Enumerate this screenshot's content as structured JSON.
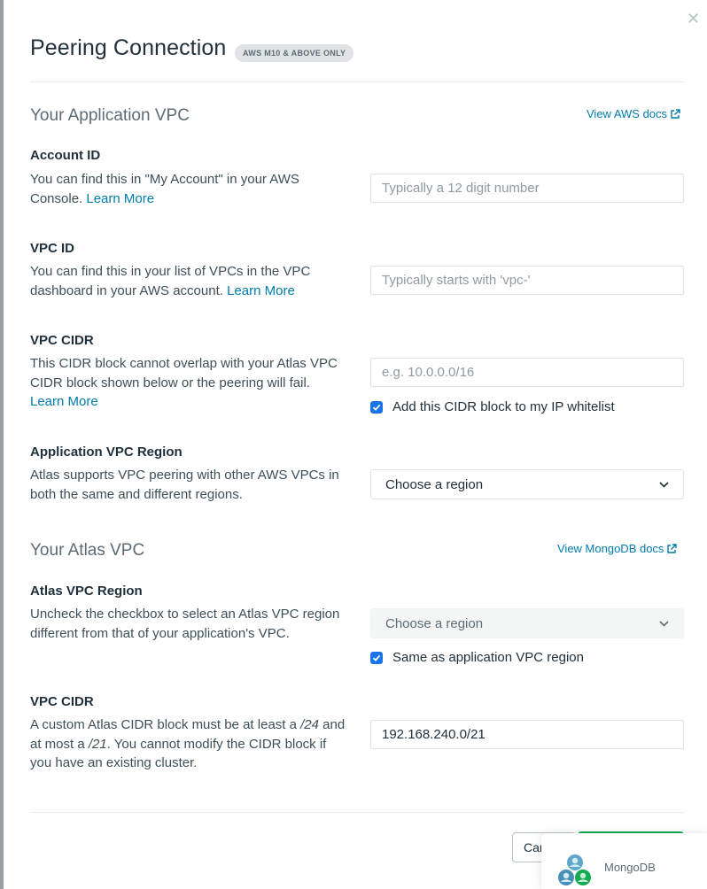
{
  "modal": {
    "title": "Peering Connection",
    "badge": "AWS M10 & ABOVE ONLY",
    "close_icon": "close-icon"
  },
  "app_section": {
    "title": "Your Application VPC",
    "docs_link": "View AWS docs",
    "account_id": {
      "label": "Account ID",
      "desc": "You can find this in \"My Account\" in your AWS Console.",
      "link": "Learn More",
      "placeholder": "Typically a 12 digit number",
      "value": ""
    },
    "vpc_id": {
      "label": "VPC ID",
      "desc": "You can find this in your list of VPCs in the VPC dashboard in your AWS account.",
      "link": "Learn More",
      "placeholder": "Typically starts with 'vpc-'",
      "value": ""
    },
    "vpc_cidr": {
      "label": "VPC CIDR",
      "desc": "This CIDR block cannot overlap with your Atlas VPC CIDR block shown below or the peering will fail.",
      "link": "Learn More",
      "placeholder": "e.g. 10.0.0.0/16",
      "value": "",
      "checkbox_label": "Add this CIDR block to my IP whitelist",
      "checked": true
    },
    "region": {
      "label": "Application VPC Region",
      "desc": "Atlas supports VPC peering with other AWS VPCs in both the same and different regions.",
      "selected": "Choose a region"
    }
  },
  "atlas_section": {
    "title": "Your Atlas VPC",
    "docs_link": "View MongoDB docs",
    "region": {
      "label": "Atlas VPC Region",
      "desc": "Uncheck the checkbox to select an Atlas VPC region different from that of your application's VPC.",
      "selected": "Choose a region",
      "checkbox_label": "Same as application VPC region",
      "checked": true
    },
    "vpc_cidr": {
      "label": "VPC CIDR",
      "desc_part1": "A custom Atlas CIDR block must be at least a ",
      "desc_em1": "/24",
      "desc_part2": " and at most a ",
      "desc_em2": "/21",
      "desc_part3": ". You cannot modify the CIDR block if you have an existing cluster.",
      "value": "192.168.240.0/21"
    }
  },
  "footer": {
    "cancel_label": "Cancel",
    "primary_label": ""
  },
  "popup": {
    "name": "MongoDB"
  },
  "colors": {
    "link": "#007cad",
    "primary": "#13aa52",
    "checkbox": "#1a73e8"
  }
}
